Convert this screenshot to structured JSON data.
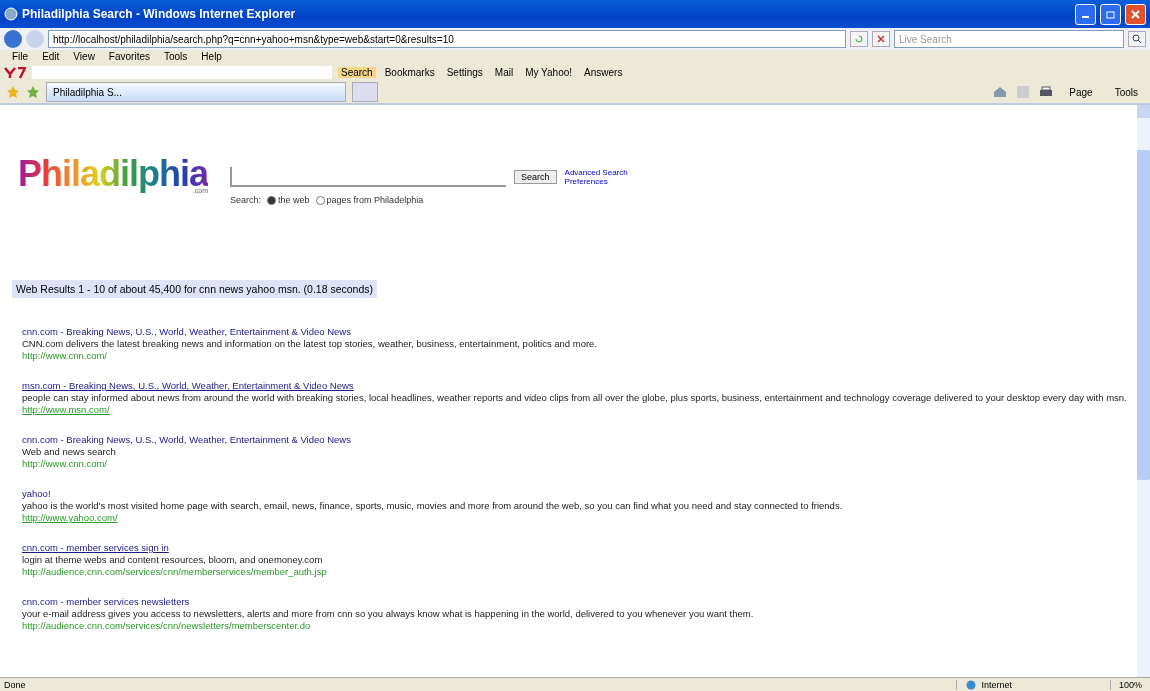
{
  "window": {
    "title": "Philadilphia Search - Windows Internet Explorer"
  },
  "address_bar": {
    "url": "http://localhost/philadilphia/search.php?q=cnn+yahoo+msn&type=web&start=0&results=10",
    "search_placeholder": "Live Search"
  },
  "menu": [
    "File",
    "Edit",
    "View",
    "Favorites",
    "Tools",
    "Help"
  ],
  "yahoo_toolbar": {
    "items": [
      {
        "label": "Search",
        "selected": true
      },
      {
        "label": "Bookmarks",
        "selected": false
      },
      {
        "label": "Settings",
        "selected": false
      },
      {
        "label": "Mail",
        "selected": false
      },
      {
        "label": "My Yahoo!",
        "selected": false
      },
      {
        "label": "Answers",
        "selected": false
      }
    ]
  },
  "tabs": [
    {
      "label": "Philadilphia S...",
      "selected": true
    }
  ],
  "command_bar": [
    "Page",
    "Tools"
  ],
  "page": {
    "logo": "Philadilphia",
    "logo_sub": ".com",
    "search_button": "Search",
    "links": [
      "Advanced Search",
      "Preferences"
    ],
    "scope_label": "Search:",
    "scopes": [
      {
        "label": "the web",
        "selected": true
      },
      {
        "label": "pages from Philadelphia",
        "selected": false
      }
    ],
    "results_header": "Web Results 1 - 10 of about 45,400 for cnn news yahoo msn. (0.18 seconds)",
    "results": [
      {
        "title": "cnn.com - Breaking News, U.S., World, Weather, Entertainment & Video News",
        "underlined": false,
        "snippet": "CNN.com delivers the latest breaking news and information on the latest top stories, weather, business, entertainment, politics and more.",
        "url": "http://www.cnn.com/",
        "url_underlined": false
      },
      {
        "title": "msn.com - Breaking News, U.S., World, Weather, Entertainment & Video News",
        "underlined": true,
        "snippet": "people can stay informed about news from around the world with breaking stories, local headlines, weather reports and video clips from all over the globe, plus sports, business, entertainment and technology coverage delivered to your desktop every day with msn.",
        "url": "http://www.msn.com/",
        "url_underlined": true
      },
      {
        "title": "cnn.com - Breaking News, U.S., World, Weather, Entertainment & Video News",
        "underlined": false,
        "snippet": "Web and news search",
        "url": "http://www.cnn.com/",
        "url_underlined": false
      },
      {
        "title": "yahoo!",
        "underlined": false,
        "snippet": "yahoo is the world's most visited home page with search, email, news, finance, sports, music, movies and more from around the web, so you can find what you need and stay connected to friends.",
        "url": "http://www.yahoo.com/",
        "url_underlined": true
      },
      {
        "title": "cnn.com - member services sign in",
        "underlined": true,
        "snippet": "login at theme webs and content resources, bloom, and onemoney.com",
        "url": "http://audience.cnn.com/services/cnn/memberservices/member_auth.jsp",
        "url_underlined": false
      },
      {
        "title": "cnn.com - member services newsletters",
        "underlined": false,
        "snippet": "your e-mail address gives you access to newsletters, alerts and more from cnn so you always know what is happening in the world, delivered to you whenever you want them.",
        "url": "http://audience.cnn.com/services/cnn/newsletters/memberscenter.do",
        "url_underlined": false
      }
    ]
  },
  "status_bar": {
    "left": "Done",
    "zone": "Internet",
    "zoom": "100%"
  }
}
